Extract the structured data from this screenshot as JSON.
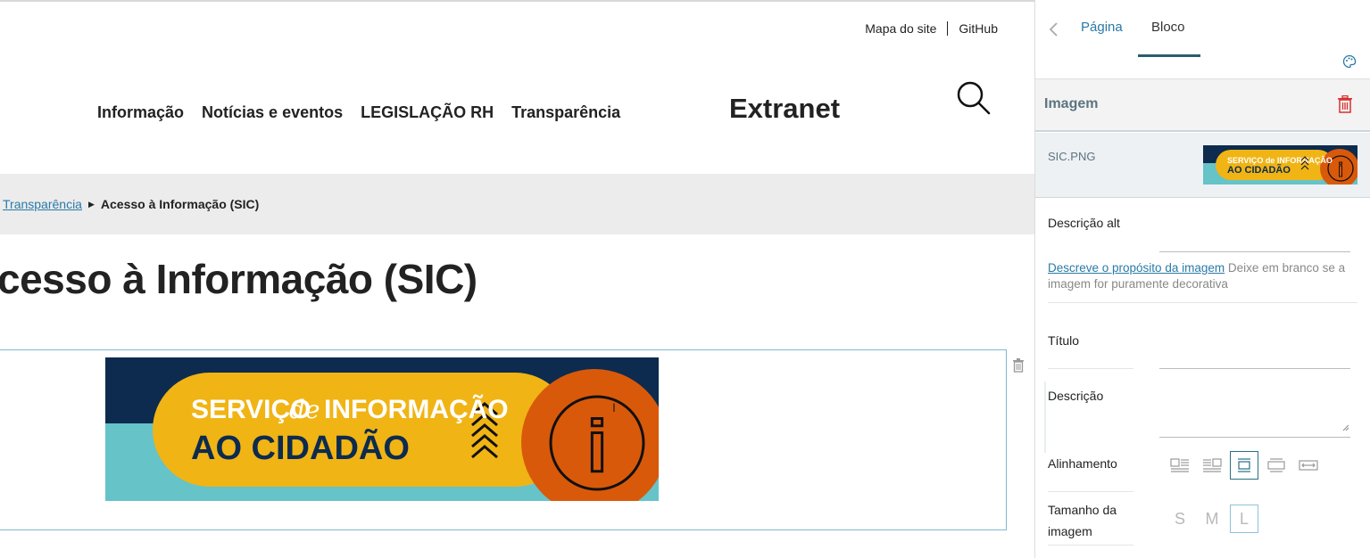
{
  "header": {
    "sitemap_link": "Mapa do site",
    "github_link": "GitHub",
    "nav": [
      "Informação",
      "Notícias e eventos",
      "LEGISLAÇÃO RH",
      "Transparência"
    ],
    "extranet": "Extranet"
  },
  "breadcrumb": {
    "parent": "Transparência",
    "current": "Acesso à Informação (SIC)"
  },
  "page": {
    "title": "cesso à Informação (SIC)"
  },
  "banner": {
    "line1_a": "SERVIÇO",
    "line1_de": "de",
    "line1_b": "INFORMAÇÃO",
    "line2": "AO CIDADÃO",
    "info_glyph": "i"
  },
  "sidebar": {
    "tabs": {
      "page": "Página",
      "block": "Bloco"
    },
    "section_title": "Imagem",
    "file_name": "SIC.PNG",
    "thumb_line1": "SERVIÇO de INFORMAÇÃO",
    "thumb_line2": "AO CIDADÃO",
    "alt_label": "Descrição alt",
    "alt_help_link": "Descreve o propósito da imagem",
    "alt_help_text": " Deixe em branco se a imagem for puramente decorativa",
    "title_label": "Título",
    "description_label": "Descrição",
    "alignment_label": "Alinhamento",
    "size_label_line1": "Tamanho da",
    "size_label_line2": "imagem",
    "sizes": [
      "S",
      "M",
      "L"
    ],
    "selected_size": "L",
    "selected_alignment": "center"
  },
  "colors": {
    "link": "#2a7aa8",
    "banner_navy": "#0d2b4e",
    "banner_teal": "#66c3c8",
    "banner_yellow": "#f0b415",
    "banner_orange": "#d9590a",
    "delete_red": "#d9302c"
  },
  "icons": [
    "search-icon",
    "chevron-left-icon",
    "palette-icon",
    "trash-icon",
    "resize-handle-icon",
    "align-left-icon",
    "align-right-icon",
    "align-center-icon",
    "align-wide-icon",
    "align-full-icon"
  ]
}
